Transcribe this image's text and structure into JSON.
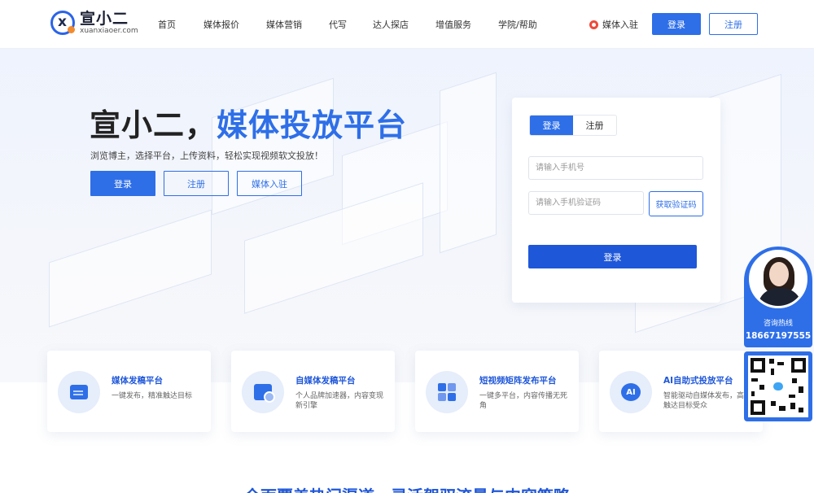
{
  "header": {
    "logo_cn": "宣小二",
    "logo_en": "xuanxiaoer.com",
    "nav": [
      "首页",
      "媒体报价",
      "媒体营销",
      "代写",
      "达人探店",
      "增值服务",
      "学院/帮助"
    ],
    "media_join": "媒体入驻",
    "login": "登录",
    "register": "注册"
  },
  "hero": {
    "title_main": "宣小二，",
    "title_accent": "媒体投放平台",
    "subtitle": "浏览博主，选择平台，上传资料，轻松实现视频软文投放！",
    "buttons": [
      "登录",
      "注册",
      "媒体入驻"
    ]
  },
  "login_card": {
    "tabs": [
      "登录",
      "注册"
    ],
    "phone_placeholder": "请输入手机号",
    "code_placeholder": "请输入手机验证码",
    "get_code": "获取验证码",
    "submit": "登录"
  },
  "features": [
    {
      "icon": "document-icon",
      "title": "媒体发稿平台",
      "desc": "一键发布，精准触达目标"
    },
    {
      "icon": "media-icon",
      "title": "自媒体发稿平台",
      "desc": "个人品牌加速器，内容变现新引擎"
    },
    {
      "icon": "grid-icon",
      "title": "短视频矩阵发布平台",
      "desc": "一键多平台，内容传播无死角"
    },
    {
      "icon": "ai-icon",
      "title": "AI自助式投放平台",
      "desc": "智能驱动自媒体发布，高效触达目标受众"
    }
  ],
  "section_title": "全面覆盖热门渠道，灵活驾驭流量与内容策略",
  "contact": {
    "label": "咨询热线",
    "phone": "18667197555"
  },
  "colors": {
    "primary": "#2e6fe8",
    "dark_primary": "#1f57d9"
  }
}
